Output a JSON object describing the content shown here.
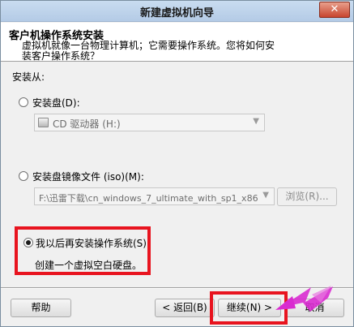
{
  "window": {
    "title": "新建虚拟机向导",
    "close_label": "✕"
  },
  "header": {
    "title": "客户机操作系统安装",
    "description": "虚拟机就像一台物理计算机；它需要操作系统。您将如何安装客户操作系统？"
  },
  "install_from": {
    "label": "安装从:",
    "options": [
      {
        "label": "安装盘(D):",
        "checked": false
      },
      {
        "label": "安装盘镜像文件 (iso)(M):",
        "checked": false
      },
      {
        "label": "我以后再安装操作系统(S)",
        "checked": true,
        "sub_label": "创建一个虚拟空白硬盘。"
      }
    ],
    "drive_combo": {
      "value": "CD 驱动器 (H:)"
    },
    "iso_path": {
      "value": "F:\\迅雷下载\\cn_windows_7_ultimate_with_sp1_x86_d"
    },
    "browse_label": "浏览(R)..."
  },
  "footer": {
    "help_label": "帮助",
    "back_label": "< 返回(B)",
    "next_label": "继续(N) >",
    "cancel_label": "取消"
  },
  "colors": {
    "highlight_red": "#e8141f",
    "arrow_magenta": "#d92bd0"
  }
}
